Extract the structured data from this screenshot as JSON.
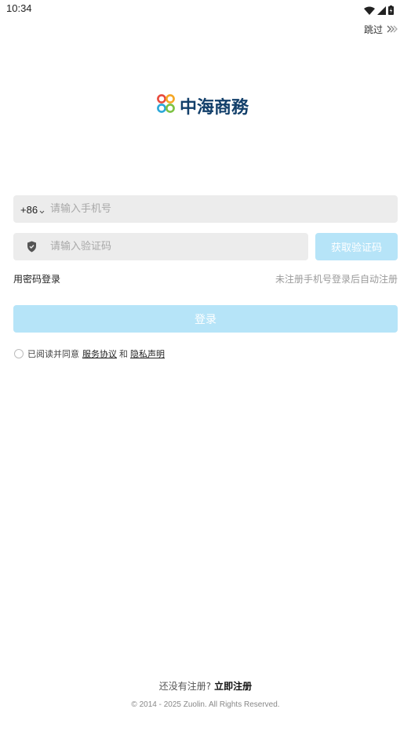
{
  "status_bar": {
    "time": "10:34",
    "icons": [
      "wifi-icon",
      "signal-icon",
      "battery-charging-icon"
    ]
  },
  "header": {
    "skip_label": "跳过",
    "skip_icon": "double-chevron-right-icon"
  },
  "logo": {
    "text": "中海商務",
    "brand_color": "#123f6a",
    "ring_colors": [
      "#e84a3c",
      "#f5a623",
      "#2aa7d8",
      "#7cc242"
    ]
  },
  "phone": {
    "country_code": "+86",
    "country_dropdown_icon": "chevron-down-icon",
    "value": "",
    "placeholder": "请输入手机号"
  },
  "verification": {
    "icon": "shield-icon",
    "value": "",
    "placeholder": "请输入验证码",
    "get_code_label": "获取验证码"
  },
  "options": {
    "password_login_label": "用密码登录",
    "auto_register_hint": "未注册手机号登录后自动注册"
  },
  "login": {
    "button_label": "登录",
    "button_color": "#b6e4f8"
  },
  "agreement": {
    "checked": false,
    "prefix": "已阅读并同意",
    "terms_link": "服务协议",
    "connector": "和",
    "privacy_link": "隐私声明"
  },
  "footer": {
    "no_account": "还没有注册?",
    "register_link": "立即注册",
    "copyright": "© 2014 - 2025 Zuolin. All Rights Reserved."
  }
}
